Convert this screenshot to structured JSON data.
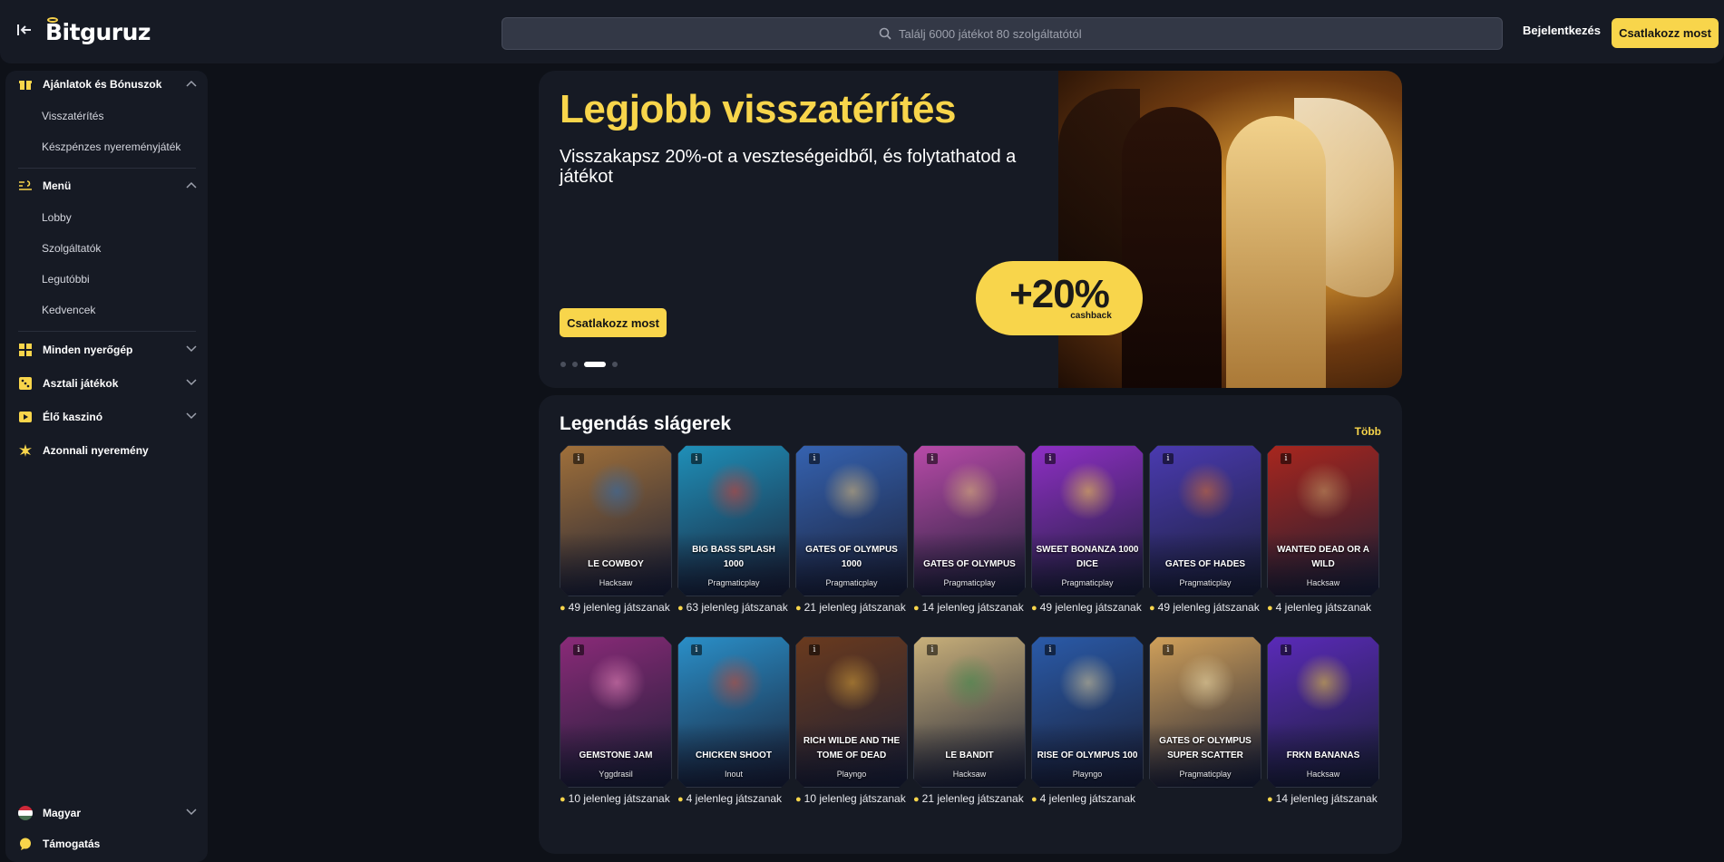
{
  "header": {
    "logo_text": "Bitguruz",
    "search_placeholder": "Találj 6000 játékot 80 szolgáltatótól",
    "login_label": "Bejelentkezés",
    "join_label": "Csatlakozz most"
  },
  "sidebar": {
    "offers": {
      "label": "Ajánlatok és Bónuszok",
      "items": [
        "Visszatérítés",
        "Készpénzes nyereményjáték"
      ]
    },
    "menu": {
      "label": "Menü",
      "items": [
        "Lobby",
        "Szolgáltatók",
        "Legutóbbi",
        "Kedvencek"
      ]
    },
    "categories": [
      "Minden nyerőgép",
      "Asztali játékok",
      "Élő kaszinó",
      "Azonnali nyeremény"
    ],
    "language_label": "Magyar",
    "support_label": "Támogatás"
  },
  "hero": {
    "title": "Legjobb visszatérítés",
    "subtitle": "Visszakapsz 20%-ot a veszteségeidből, és folytathatod a játékot",
    "button_label": "Csatlakozz most",
    "badge_value": "+20%",
    "badge_caption": "cashback",
    "slides_total": 4,
    "active_slide": 3
  },
  "games": {
    "title": "Legendás slágerek",
    "more_label": "Több",
    "info_glyph": "i",
    "rows": [
      [
        {
          "name": "LE COWBOY",
          "provider": "Hacksaw",
          "players": "49 jelenleg játszanak",
          "color": "#a0703a",
          "accent": "#2c6fb8"
        },
        {
          "name": "BIG BASS SPLASH 1000",
          "provider": "Pragmaticplay",
          "players": "63 jelenleg játszanak",
          "color": "#1f8fb8",
          "accent": "#e23a2a"
        },
        {
          "name": "GATES OF OLYMPUS 1000",
          "provider": "Pragmaticplay",
          "players": "21 jelenleg játszanak",
          "color": "#3562b0",
          "accent": "#e6c37a"
        },
        {
          "name": "GATES OF OLYMPUS",
          "provider": "Pragmaticplay",
          "players": "14 jelenleg játszanak",
          "color": "#b84aa8",
          "accent": "#e6c37a"
        },
        {
          "name": "SWEET BONANZA 1000 DICE",
          "provider": "Pragmaticplay",
          "players": "49 jelenleg játszanak",
          "color": "#8e2fc4",
          "accent": "#ffd84a"
        },
        {
          "name": "GATES OF HADES",
          "provider": "Pragmaticplay",
          "players": "49 jelenleg játszanak",
          "color": "#4a3ab0",
          "accent": "#e8742a"
        },
        {
          "name": "WANTED DEAD OR A WILD",
          "provider": "Hacksaw",
          "players": "4 jelenleg játszanak",
          "color": "#a8261e",
          "accent": "#c9a26a"
        }
      ],
      [
        {
          "name": "GEMSTONE JAM",
          "provider": "Yggdrasil",
          "players": "10 jelenleg játszanak",
          "color": "#8a2a78",
          "accent": "#f08cc0"
        },
        {
          "name": "CHICKEN SHOOT",
          "provider": "Inout",
          "players": "4 jelenleg játszanak",
          "color": "#2a8fc8",
          "accent": "#d9462a"
        },
        {
          "name": "RICH WILDE AND THE TOME OF DEAD",
          "provider": "Playngo",
          "players": "10 jelenleg játszanak",
          "color": "#6a3a1e",
          "accent": "#d9a43a"
        },
        {
          "name": "LE BANDIT",
          "provider": "Hacksaw",
          "players": "21 jelenleg játszanak",
          "color": "#c9b07a",
          "accent": "#3a8a4a"
        },
        {
          "name": "RISE OF OLYMPUS 100",
          "provider": "Playngo",
          "players": "4 jelenleg játszanak",
          "color": "#2a5aa8",
          "accent": "#e6d29a"
        },
        {
          "name": "GATES OF OLYMPUS SUPER SCATTER",
          "provider": "Pragmaticplay",
          "players": "",
          "color": "#d0a05a",
          "accent": "#f3e2b0"
        },
        {
          "name": "FRKN BANANAS",
          "provider": "Hacksaw",
          "players": "14 jelenleg játszanak",
          "color": "#5a2ab8",
          "accent": "#f5d53a"
        }
      ]
    ]
  },
  "colors": {
    "accent": "#f8d54b",
    "background": "#0e1118",
    "panel": "#161a24"
  }
}
